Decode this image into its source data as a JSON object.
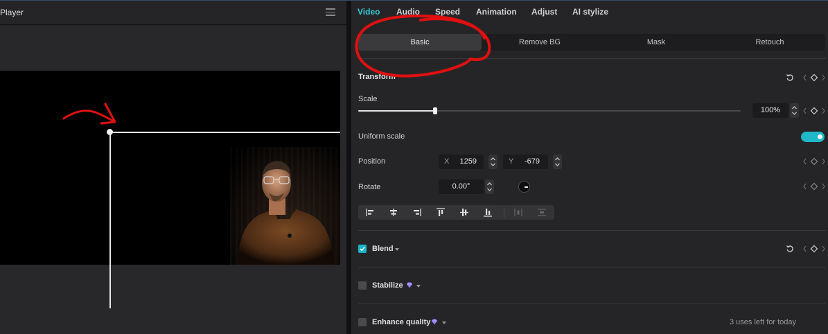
{
  "player": {
    "title": "Player"
  },
  "inspector": {
    "tabs": [
      {
        "label": "Video",
        "active": true
      },
      {
        "label": "Audio",
        "active": false
      },
      {
        "label": "Speed",
        "active": false
      },
      {
        "label": "Animation",
        "active": false
      },
      {
        "label": "Adjust",
        "active": false
      },
      {
        "label": "AI stylize",
        "active": false
      }
    ],
    "subtabs": [
      {
        "label": "Basic",
        "active": true
      },
      {
        "label": "Remove BG",
        "active": false
      },
      {
        "label": "Mask",
        "active": false
      },
      {
        "label": "Retouch",
        "active": false
      }
    ],
    "transform": {
      "section_label": "Transform",
      "scale_label": "Scale",
      "scale_value": "100%",
      "uniform_scale_label": "Uniform scale",
      "uniform_scale_on": true,
      "position_label": "Position",
      "x_label": "X",
      "x_value": "1259",
      "y_label": "Y",
      "y_value": "-679",
      "rotate_label": "Rotate",
      "rotate_value": "0.00°"
    },
    "blend": {
      "label": "Blend",
      "checked": true
    },
    "stabilize": {
      "label": "Stabilize",
      "checked": false
    },
    "enhance_quality": {
      "label": "Enhance quality",
      "checked": false,
      "usage_note": "3 uses left for today"
    }
  },
  "colors": {
    "accent": "#35c8d8",
    "annotation_red": "#e01010"
  },
  "icons": [
    "menu-icon",
    "reset-icon",
    "keyframe-icon",
    "stepper-icon",
    "toggle",
    "dial-icon",
    "align-left-icon",
    "align-center-h-icon",
    "align-right-icon",
    "align-top-icon",
    "align-center-v-icon",
    "align-bottom-icon",
    "distribute-h-icon",
    "distribute-v-icon",
    "checkbox",
    "chevron-down-icon",
    "premium-gem-icon"
  ]
}
